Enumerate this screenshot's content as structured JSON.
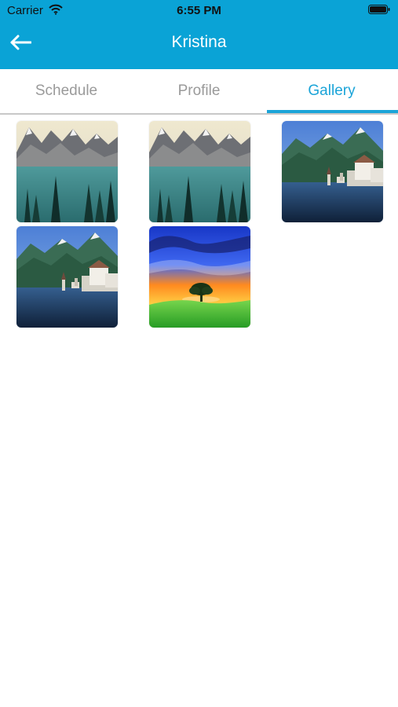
{
  "status_bar": {
    "carrier": "Carrier",
    "time": "6:55 PM",
    "battery_icon": "battery-icon",
    "wifi_icon": "wifi-icon"
  },
  "header": {
    "title": "Kristina",
    "back_icon": "back-arrow-icon",
    "color": "#0aa3d6"
  },
  "tabs": [
    {
      "label": "Schedule",
      "active": false
    },
    {
      "label": "Profile",
      "active": false
    },
    {
      "label": "Gallery",
      "active": true
    }
  ],
  "gallery": {
    "images": [
      {
        "scene": "mountain-lake-pines"
      },
      {
        "scene": "mountain-lake-pines"
      },
      {
        "scene": "alpine-village-lake"
      },
      {
        "scene": "alpine-village-lake"
      },
      {
        "scene": "sunset-tree-field"
      }
    ]
  },
  "accent_color": "#1ba4d8"
}
